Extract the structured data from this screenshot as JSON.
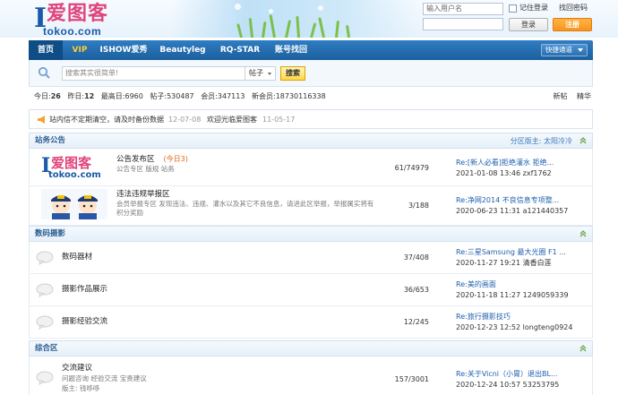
{
  "brand": {
    "letter": "I",
    "name_cn": "爱图客",
    "url": "tokoo.com"
  },
  "login": {
    "username_placeholder": "输入用户名",
    "remember_label": "记住登录",
    "forgot_label": "找回密码",
    "login_button": "登录",
    "register_button": "注册"
  },
  "nav": {
    "items": [
      {
        "label": "首页"
      },
      {
        "label": "VIP"
      },
      {
        "label": "ISHOW爱秀"
      },
      {
        "label": "Beautyleg"
      },
      {
        "label": "RQ-STAR"
      },
      {
        "label": "账号找回"
      }
    ],
    "quick_label": "快捷通道"
  },
  "search": {
    "placeholder": "搜索其实很简单!",
    "type_label": "帖子",
    "button": "搜索"
  },
  "stats": {
    "today_label": "今日:",
    "today": "26",
    "yesterday_label": "昨日:",
    "yesterday": "12",
    "max_label": "最高日:",
    "max": "6960",
    "posts_label": "帖子:",
    "posts": "530487",
    "members_label": "会员:",
    "members": "347113",
    "newest_label": "新会员:",
    "newest": "18730116338",
    "link_new": "新帖",
    "link_digest": "精华"
  },
  "notices": [
    {
      "text": "站内信不定期清空，请及时备份数据",
      "date": "12-07-08"
    },
    {
      "text": "欢迎光临爱图客",
      "date": "11-05-17"
    }
  ],
  "sections": [
    {
      "title": "站务公告",
      "moderators": "分区版主: 太阳冷冷",
      "forums": [
        {
          "name": "公告发布区",
          "today": "(今日3)",
          "desc": "公告专区 版规 站务",
          "count": "61/74979",
          "last_title": "Re:[新人必看]拒绝灌水 拒绝...",
          "last_time": "2021-01-08 13:46 zxf1762"
        },
        {
          "name": "违法违规举报区",
          "today": "",
          "desc": "会员举报专区 发现违法、违规、灌水以及其它不良信息，请进此区举报，举报属实将有积分奖励",
          "count": "3/188",
          "last_title": "Re:净网2014 不良信息专项整...",
          "last_time": "2020-06-23 11:31 a121440357"
        }
      ]
    },
    {
      "title": "数码摄影",
      "moderators": "",
      "forums": [
        {
          "name": "数码器材",
          "count": "37/408",
          "last_title": "Re:三星Samsung 最大光圈 F1 ...",
          "last_time": "2020-11-27 19:21 清香白莲"
        },
        {
          "name": "摄影作品展示",
          "count": "36/653",
          "last_title": "Re:美的画面",
          "last_time": "2020-11-18 11:27 1249059339"
        },
        {
          "name": "摄影经验交流",
          "count": "12/245",
          "last_title": "Re:旅行摄影技巧",
          "last_time": "2020-12-23 12:52 longteng0924"
        }
      ]
    },
    {
      "title": "综合区",
      "moderators": "",
      "forums": [
        {
          "name": "交流建议",
          "desc": "问题咨询 经验交流 宝贵建议",
          "desc2": "版主: 钱哆哆",
          "count": "157/3001",
          "last_title": "Re:关于Vicni（小胃）退出BL...",
          "last_time": "2020-12-24 10:57 53253795"
        }
      ]
    }
  ],
  "colors": {
    "nav": "#1c5f9e",
    "accent_orange": "#f7941d",
    "link": "#1d5fae",
    "logo_pink": "#e0457b"
  }
}
